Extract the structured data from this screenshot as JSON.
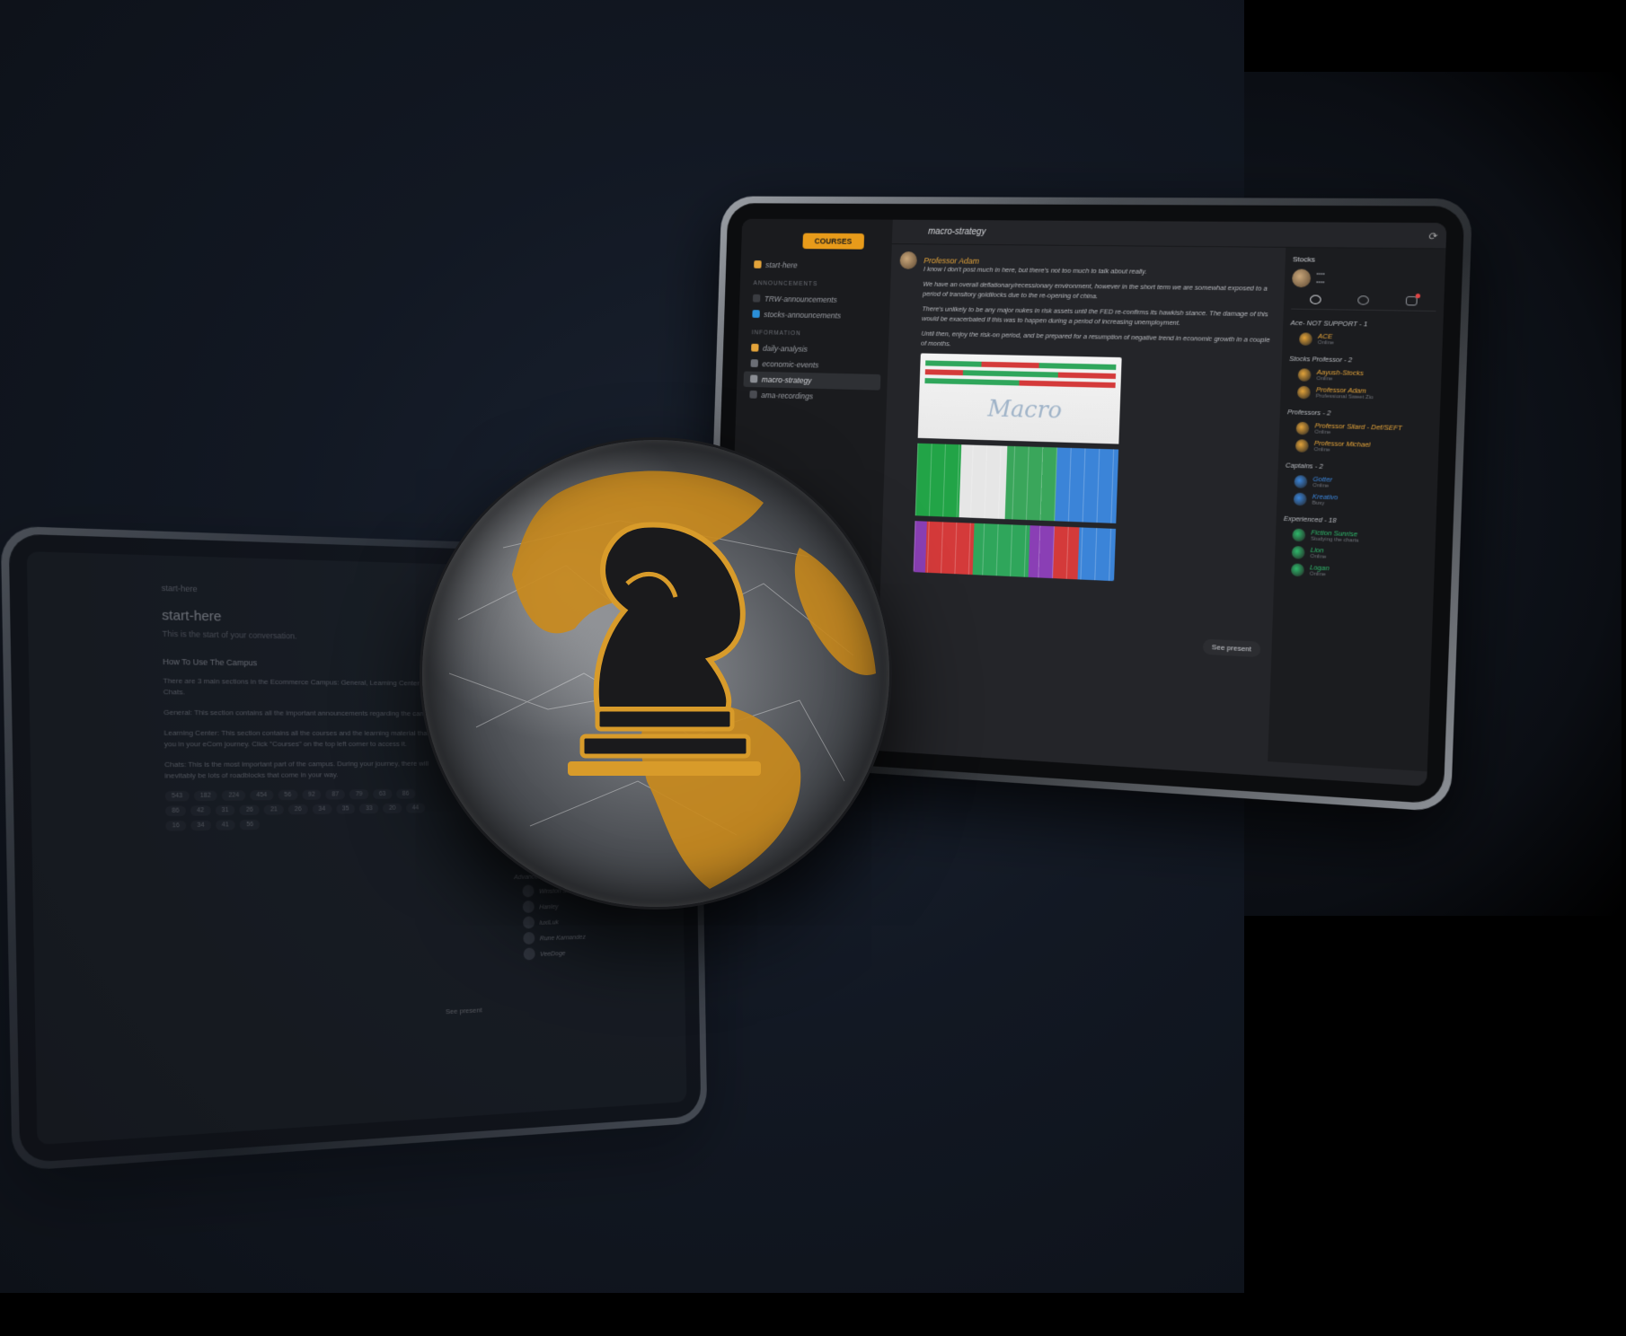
{
  "front": {
    "courses_label": "COURSES",
    "sidebar": {
      "start_here": "start-here",
      "sections": [
        {
          "title": "ANNOUNCEMENTS",
          "channels": [
            "TRW-announcements",
            "stocks-announcements"
          ]
        },
        {
          "title": "INFORMATION",
          "channels": [
            "daily-analysis",
            "economic-events",
            "macro-strategy",
            "ama-recordings"
          ]
        }
      ],
      "active_channel": "macro-strategy"
    },
    "header": {
      "channel": "macro-strategy"
    },
    "message": {
      "author": "Professor Adam",
      "paragraphs": [
        "I know I don't post much in here, but there's not too much to talk about really.",
        "We have an overall deflationary/recessionary environment, however in the short term we are somewhat exposed to a period of transitory goldilocks due to the re-opening of china.",
        "There's unlikely to be any major nukes in risk assets until the FED re-confirms its hawkish stance. The damage of this would be exacerbated if this was to happen during a period of increasing unemployment.",
        "Until then, enjoy the risk-on period, and be prepared for a resumption of negative trend in economic growth in a couple of months."
      ],
      "chart_watermark": "Macro"
    },
    "see_present": "See present",
    "members": {
      "server_name": "Stocks",
      "groups": [
        {
          "title": "Ace- NOT SUPPORT - 1",
          "members": [
            {
              "name": "ACE",
              "status": "Online",
              "color": "#e3a33a"
            }
          ]
        },
        {
          "title": "Stocks Professor - 2",
          "members": [
            {
              "name": "Aayush-Stocks",
              "status": "Online",
              "color": "#e3a33a"
            },
            {
              "name": "Professor Adam",
              "status": "Professional Sweet Zio",
              "color": "#e3a33a"
            }
          ]
        },
        {
          "title": "Professors - 2",
          "members": [
            {
              "name": "Professor Silard - Def/SEFT",
              "status": "Online",
              "color": "#e3a33a"
            },
            {
              "name": "Professor Michael",
              "status": "Online",
              "color": "#e3a33a"
            }
          ]
        },
        {
          "title": "Captains - 2",
          "members": [
            {
              "name": "Gotter",
              "status": "Online",
              "color": "#3b84d8"
            },
            {
              "name": "Kreativo",
              "status": "Busy",
              "color": "#3b84d8"
            }
          ]
        },
        {
          "title": "Experienced - 18",
          "members": [
            {
              "name": "Fiction Sunrise",
              "status": "Studying the charts",
              "color": "#2fb76b"
            },
            {
              "name": "Lion",
              "status": "Online",
              "color": "#2fb76b"
            },
            {
              "name": "Logan",
              "status": "Online",
              "color": "#2fb76b"
            }
          ]
        }
      ]
    }
  },
  "back": {
    "crumb": "start-here",
    "title": "start-here",
    "subtitle": "This is the start of your conversation.",
    "author": "How To Use The Campus",
    "paragraphs": [
      "There are 3 main sections in the Ecommerce Campus: General, Learning Center and the Chats.",
      "General: This section contains all the important announcements regarding the campus.",
      "Learning Center: This section contains all the courses and the learning material that will help you in your eCom journey. Click \"Courses\" on the top left corner to access it.",
      "Chats: This is the most important part of the campus. During your journey, there will inevitably be lots of roadblocks that come in your way."
    ],
    "reactions": [
      "543",
      "182",
      "224",
      "454",
      "56",
      "92",
      "87",
      "79",
      "63",
      "86",
      "86",
      "42",
      "31",
      "26",
      "21",
      "26",
      "34",
      "35",
      "33",
      "20",
      "44",
      "16",
      "34",
      "41",
      "56"
    ],
    "members_group": "Advanced - 5",
    "members": [
      "Winston Sevens",
      "Hanley",
      "luxiLuk",
      "Rune Karnandez",
      "VeeDoge"
    ],
    "see_present": "See present"
  }
}
